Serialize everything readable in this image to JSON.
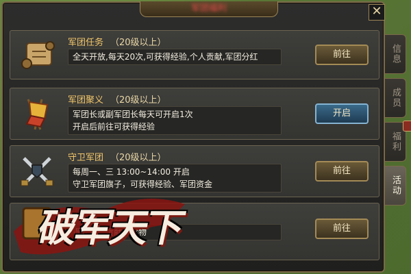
{
  "title": "军团福利",
  "close": "✕",
  "cards": [
    {
      "title": "军团任务",
      "level": "（20级以上）",
      "desc": "全天开放,每天20次,可获得经验,个人贡献,军团分红",
      "button": "前往",
      "icon": "scroll-icon",
      "style": "normal"
    },
    {
      "title": "军团聚义",
      "level": "（20级以上）",
      "desc": "军团长或副军团长每天可开启1次\n开启后前往可获得经验",
      "button": "开启",
      "icon": "banner-icon",
      "style": "blue"
    },
    {
      "title": "守卫军团",
      "level": "（20级以上）",
      "desc": "每周一、三 13:00~14:00 开启\n守卫军团旗子，可获得经验、军团资金",
      "button": "前往",
      "icon": "crossed-swords-icon",
      "style": "normal"
    },
    {
      "title": "",
      "level": "",
      "desc": "得经验、贡献、宝物",
      "button": "前往",
      "icon": "chest-icon",
      "style": "normal"
    }
  ],
  "side_tabs": [
    {
      "label": "信息",
      "active": false
    },
    {
      "label": "成员",
      "active": false
    },
    {
      "label": "福利",
      "active": false
    },
    {
      "label": "活动",
      "active": true
    }
  ],
  "logo": {
    "text": "破军天下"
  }
}
